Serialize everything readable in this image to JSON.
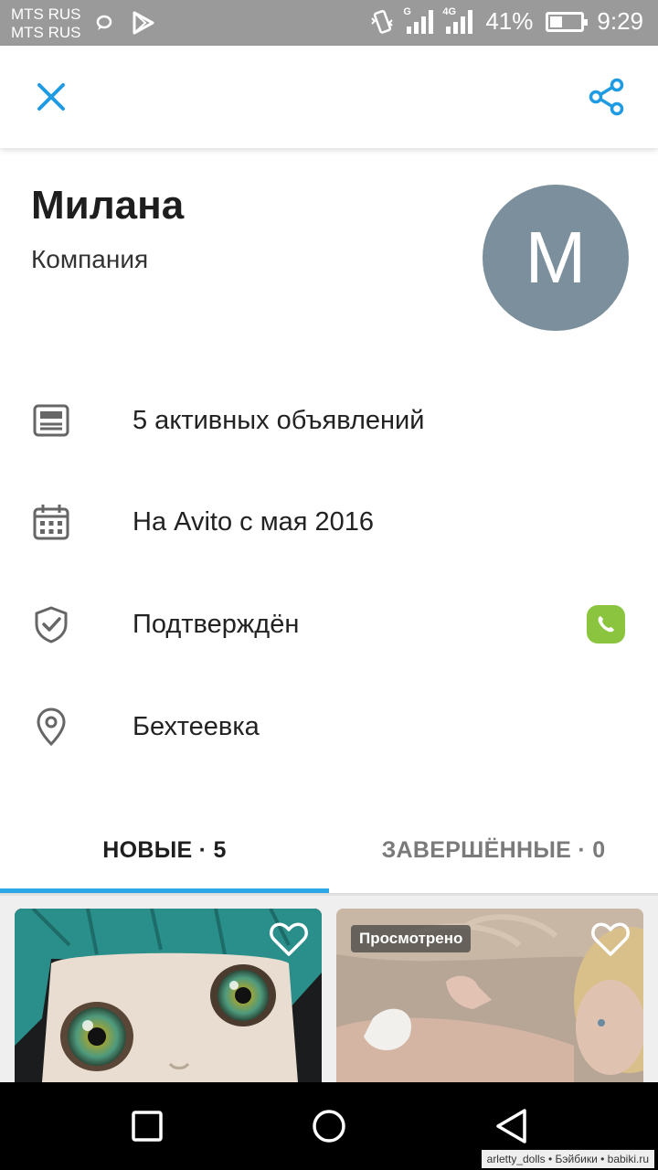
{
  "status_bar": {
    "carrier_1": "MTS RUS",
    "carrier_2": "MTS RUS",
    "network_1": "G",
    "network_2": "4G",
    "battery_percent": "41%",
    "battery_level": 0.41,
    "time": "9:29"
  },
  "app_bar": {
    "close_icon": "close-icon",
    "share_icon": "share-icon",
    "accent_color": "#1e9be3"
  },
  "profile": {
    "name": "Милана",
    "type": "Компания",
    "avatar_letter": "M",
    "avatar_color": "#7b8f9c"
  },
  "info": {
    "listings": "5 активных объявлений",
    "since": "На Avito с мая 2016",
    "verified": "Подтверждён",
    "location": "Бехтеевка",
    "phone_badge_color": "#8bc53f"
  },
  "tabs": {
    "new_label": "НОВЫЕ · 5",
    "completed_label": "ЗАВЕРШЁННЫЕ · 0",
    "indicator_color": "#2ba7e6"
  },
  "listings": [
    {
      "badge": "",
      "favorite_icon": "heart-outline-icon"
    },
    {
      "badge": "Просмотрено",
      "favorite_icon": "heart-outline-icon"
    }
  ],
  "watermark": "arletty_dolls • Бэйбики • babiki.ru"
}
